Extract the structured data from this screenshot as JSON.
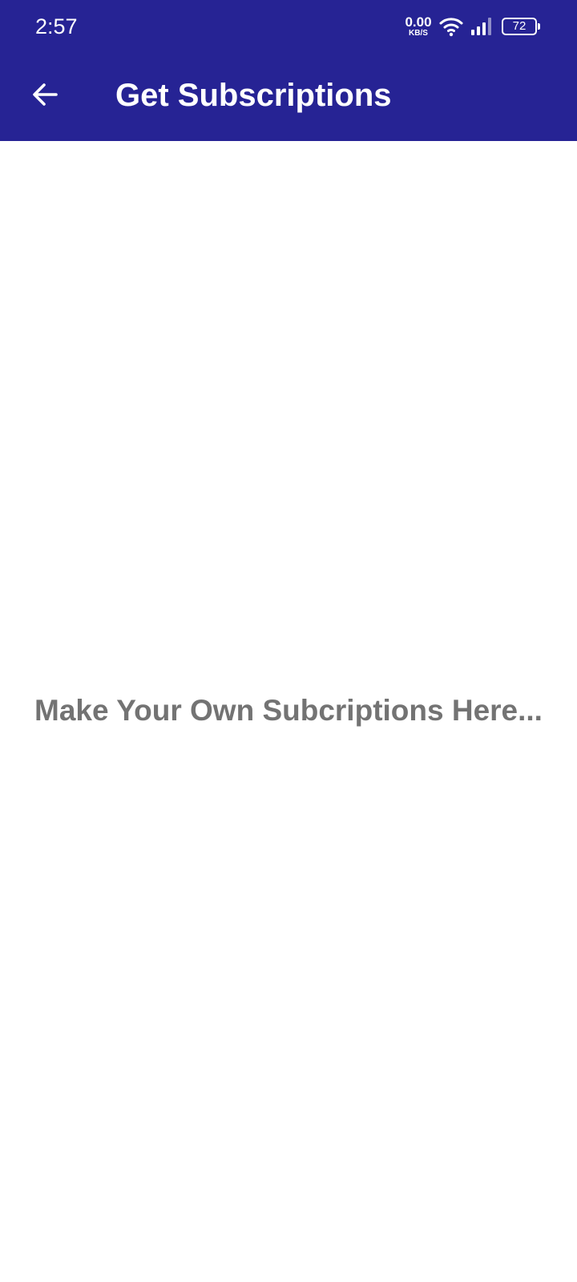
{
  "status_bar": {
    "time": "2:57",
    "net_speed_value": "0.00",
    "net_speed_unit": "KB/S",
    "battery_level": "72",
    "wifi_icon": "wifi-icon",
    "signal_icon": "cell-signal-icon"
  },
  "toolbar": {
    "title": "Get Subscriptions",
    "back_icon": "arrow-left-icon",
    "background_color": "#262394",
    "text_color": "#ffffff"
  },
  "main": {
    "empty_message": "Make Your Own Subcriptions Here...",
    "message_color": "#737373"
  }
}
